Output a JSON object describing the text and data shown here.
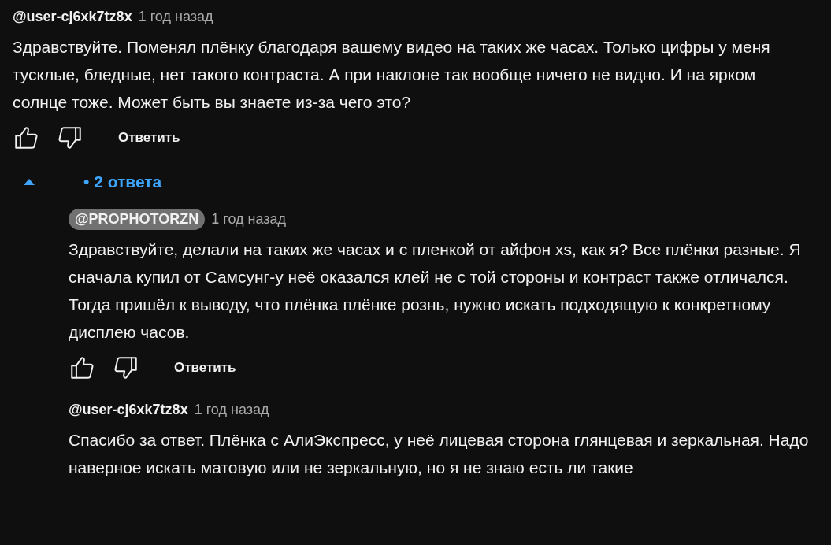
{
  "comment": {
    "author": "@user-cj6xk7tz8x",
    "author_highlighted": false,
    "time": "1 год назад",
    "text": "Здравствуйте. Поменял плёнку благодаря вашему видео на таких же часах. Только цифры у меня тусклые, бледные, нет такого контраста. А при наклоне так вообще ничего не видно. И на ярком солнце тоже. Может быть вы знаете из-за чего это?",
    "reply_label": "Ответить"
  },
  "replies_toggle": {
    "expanded": true,
    "label": "• 2 ответа"
  },
  "replies": [
    {
      "author": "@PROPHOTORZN",
      "author_highlighted": true,
      "time": "1 год назад",
      "text": "Здравствуйте, делали на таких же часах и с пленкой от айфон xs, как я? Все плёнки разные. Я сначала купил от Самсунг-у неё оказался клей не с той стороны и контраст также отличался. Тогда пришёл к выводу, что плёнка плёнке рознь, нужно искать подходящую к конкретному дисплею часов.",
      "reply_label": "Ответить"
    },
    {
      "author": "@user-cj6xk7tz8x",
      "author_highlighted": false,
      "time": "1 год назад",
      "text": "Спасибо за ответ. Плёнка с АлиЭкспресс, у неё лицевая сторона глянцевая и зеркальная. Надо наверное искать матовую или не зеркальную, но я не знаю есть ли такие"
    }
  ]
}
